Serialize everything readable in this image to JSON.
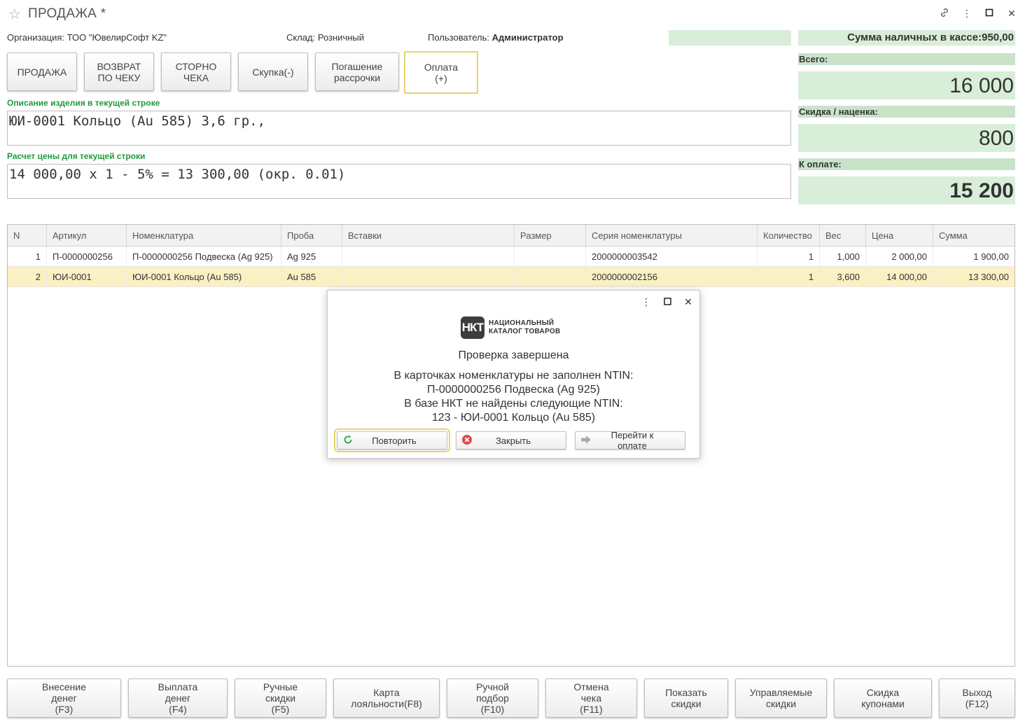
{
  "window": {
    "title": "ПРОДАЖА *",
    "icons": [
      "star-icon",
      "link-icon",
      "more-icon",
      "maximize-icon",
      "close-icon"
    ]
  },
  "info": {
    "org_label": "Организация:",
    "org_value": "ТОО \"ЮвелирСофт KZ\"",
    "warehouse_label": "Склад:",
    "warehouse_value": "Розничный",
    "user_label": "Пользователь:",
    "user_value": "Администратор",
    "cash": "Сумма наличных в кассе:950,00"
  },
  "ops": [
    {
      "label": "ПРОДАЖА"
    },
    {
      "label": "ВОЗВРАТ\nПО ЧЕКУ"
    },
    {
      "label": "СТОРНО\nЧЕКА"
    },
    {
      "label": "Скупка(-)"
    },
    {
      "label": "Погашение\nрассрочки"
    },
    {
      "label": "Оплата\n(+)"
    }
  ],
  "description": {
    "label": "Описание изделия в текущей строке",
    "value": "ЮИ-0001 Кольцо (Au 585) 3,6 гр.,"
  },
  "calc": {
    "label": "Расчет цены для текущей строки",
    "value": "14 000,00 x 1 - 5% = 13 300,00 (окр. 0.01)"
  },
  "totals": {
    "total_label": "Всего:",
    "total_value": "16 000",
    "discount_label": "Скидка / наценка:",
    "discount_value": "800",
    "pay_label": "К оплате:",
    "pay_value": "15 200"
  },
  "table": {
    "columns": [
      "N",
      "Артикул",
      "Номенклатура",
      "Проба",
      "Вставки",
      "Размер",
      "Серия номенклатуры",
      "Количество",
      "Вес",
      "Цена",
      "Сумма"
    ],
    "rows": [
      [
        "1",
        "П-0000000256",
        "П-0000000256 Подвеска (Ag 925)",
        "Ag 925",
        "",
        "",
        "2000000003542",
        "1",
        "1,000",
        "2 000,00",
        "1 900,00"
      ],
      [
        "2",
        "ЮИ-0001",
        "ЮИ-0001 Кольцо (Au 585)",
        "Au 585",
        "",
        "",
        "2000000002156",
        "1",
        "3,600",
        "14 000,00",
        "13 300,00"
      ]
    ]
  },
  "dialog": {
    "logo_mark": "НКТ",
    "logo_line1": "НАЦИОНАЛЬНЫЙ",
    "logo_line2": "КАТАЛОГ ТОВАРОВ",
    "title": "Проверка завершена",
    "lines": [
      "В карточках номенклатуры не заполнен NTIN:",
      "П-0000000256 Подвеска (Ag 925)",
      "В базе НКТ не найдены следующие NTIN:",
      "123 - ЮИ-0001 Кольцо (Au 585)"
    ],
    "buttons": {
      "retry": "Повторить",
      "close": "Закрыть",
      "goto_payment": "Перейти к оплате"
    }
  },
  "footer": [
    {
      "label": "Внесение\nденег\n(F3)"
    },
    {
      "label": "Выплата\nденег\n(F4)"
    },
    {
      "label": "Ручные\nскидки\n(F5)"
    },
    {
      "label": "Карта\nлояльности(F8)"
    },
    {
      "label": "Ручной\nподбор\n(F10)"
    },
    {
      "label": "Отмена\nчека\n(F11)"
    },
    {
      "label": "Показать\nскидки"
    },
    {
      "label": "Управляемые\nскидки"
    },
    {
      "label": "Скидка\nкупонами"
    },
    {
      "label": "Выход\n(F12)"
    }
  ],
  "colors": {
    "accent_green": "#1f9a3b",
    "panel_green": "#d8eed8",
    "selected_row": "#fbf0c4",
    "focus_yellow": "#e8d36a"
  }
}
